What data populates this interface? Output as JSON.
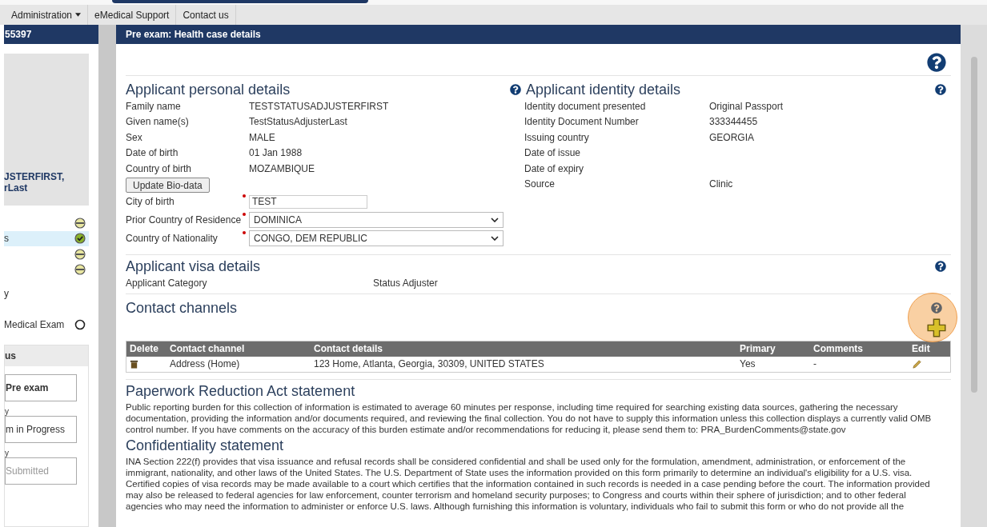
{
  "nav": {
    "items": [
      {
        "label": "Administration",
        "dropdown": true
      },
      {
        "label": "eMedical Support",
        "dropdown": false
      },
      {
        "label": "Contact us",
        "dropdown": false
      }
    ]
  },
  "sidebar": {
    "case_number": "55397",
    "applicant_name": [
      "JSTERFIRST,",
      "rLast"
    ],
    "steps": [
      {
        "kind": "partial",
        "selected": false
      },
      {
        "label": "s",
        "kind": "done",
        "selected": true
      },
      {
        "kind": "partial",
        "selected": false
      },
      {
        "kind": "partial",
        "selected": false
      },
      {
        "label": "y",
        "kind": "none",
        "selected": false
      },
      {
        "label": "Medical Exam",
        "kind": "empty",
        "selected": false
      }
    ],
    "status_section": {
      "title": "us",
      "stages": [
        {
          "label": "Pre exam",
          "bold": true,
          "disabled": false
        },
        {
          "caption": "y",
          "label": "m in Progress",
          "bold": false,
          "disabled": false
        },
        {
          "caption": "y",
          "label": "Submitted",
          "bold": false,
          "disabled": true
        }
      ]
    }
  },
  "panel": {
    "title": "Pre exam: Health case details",
    "personal": {
      "title": "Applicant personal details",
      "rows": [
        {
          "label": "Family name",
          "value": "TESTSTATUSADJUSTERFIRST"
        },
        {
          "label": "Given name(s)",
          "value": "TestStatusAdjusterLast"
        },
        {
          "label": "Sex",
          "value": "MALE"
        },
        {
          "label": "Date of birth",
          "value": "01 Jan 1988"
        },
        {
          "label": "Country of birth",
          "value": "MOZAMBIQUE"
        }
      ],
      "button": "Update Bio-data",
      "fields": [
        {
          "kind": "text",
          "label": "City of birth",
          "required": true,
          "value": "TEST"
        },
        {
          "kind": "select",
          "label": "Prior Country of Residence",
          "required": true,
          "value": "DOMINICA"
        },
        {
          "kind": "select",
          "label": "Country of Nationality",
          "required": true,
          "value": "CONGO, DEM REPUBLIC"
        }
      ]
    },
    "identity": {
      "title": "Applicant identity details",
      "rows": [
        {
          "label": "Identity document presented",
          "value": "Original Passport"
        },
        {
          "label": "Identity Document Number",
          "value": "333344455"
        },
        {
          "label": "Issuing country",
          "value": "GEORGIA"
        },
        {
          "label": "Date of issue"
        },
        {
          "label": "Date of expiry"
        },
        {
          "label": "Source",
          "value": "Clinic"
        }
      ]
    },
    "visa": {
      "title": "Applicant visa details",
      "rows": [
        {
          "label": "Applicant Category",
          "value": "Status Adjuster"
        }
      ]
    },
    "contacts": {
      "title": "Contact channels",
      "columns": [
        "Delete",
        "Contact channel",
        "Contact details",
        "Primary",
        "Comments",
        "Edit"
      ],
      "rows": [
        {
          "channel": "Address (Home)",
          "details": "123 Home, Atlanta, Georgia, 30309, UNITED STATES",
          "primary": "Yes",
          "comments": "-"
        }
      ]
    },
    "paperwork": {
      "title": "Paperwork Reduction Act statement",
      "lines": [
        "Public reporting burden for this collection of information is estimated to average 60 minutes per response, including time required for searching existing data sources, gathering the necessary",
        "documentation, providing the information and/or documents required, and reviewing the final collection. You do not have to supply this information unless this collection displays a currently valid OMB",
        "control number. If you have comments on the accuracy of this burden estimate and/or recommendations for reducing it, please send them to: PRA_BurdenComments@state.gov"
      ]
    },
    "confidentiality": {
      "title": "Confidentiality statement",
      "lines": [
        "INA Section 222(f) provides that visa issuance and refusal records shall be considered confidential and shall be used only for the formulation, amendment, administration, or enforcement of the",
        "immigrant, nationality, and other laws of the United States. The U.S. Department of State uses the information provided on this form primarily to determine an individual's eligibility for a U.S. visa.",
        "Certified copies of visa records may be made available to a court which certifies that the information contained in such records is needed in a case pending before the court. The information provided",
        "may also be released to federal agencies for law enforcement, counter terrorism and homeland security purposes; to Congress and courts within their sphere of jurisdiction; and to other federal",
        "agencies who may need the information to administer or enforce U.S. laws. Although furnishing this information is voluntary, individuals who fail to submit this form or who do not provide all the"
      ]
    }
  }
}
